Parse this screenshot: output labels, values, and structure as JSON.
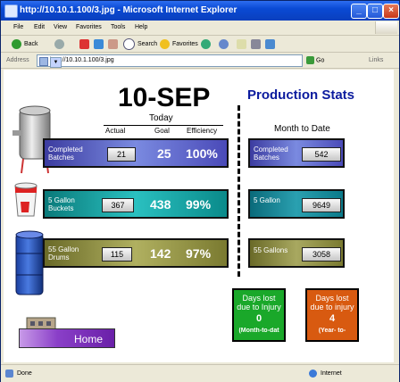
{
  "window": {
    "title": "http://10.10.1.100/3.jpg - Microsoft Internet Explorer",
    "minimize": "_",
    "maximize": "□",
    "close": "×"
  },
  "menu": [
    "File",
    "Edit",
    "View",
    "Favorites",
    "Tools",
    "Help"
  ],
  "toolbar": {
    "back": "Back",
    "search": "Search",
    "favorites": "Favorites"
  },
  "address": {
    "label": "Address",
    "url": "http://10.10.1.100/3.jpg",
    "go": "Go",
    "links": "Links"
  },
  "status": {
    "text": "Done",
    "zone": "Internet"
  },
  "page": {
    "date": "10-SEP",
    "title": "Production Stats",
    "today_label": "Today",
    "mtd_label": "Month to Date",
    "columns": {
      "actual": "Actual",
      "goal": "Goal",
      "efficiency": "Efficiency"
    },
    "rows": [
      {
        "label1": "Completed",
        "label2": "Batches",
        "actual": "21",
        "goal": "25",
        "efficiency": "100%",
        "mtd_label1": "Completed",
        "mtd_label2": "Batches",
        "mtd": "542"
      },
      {
        "label1": "5 Gallon",
        "label2": "Buckets",
        "actual": "367",
        "goal": "438",
        "efficiency": "99%",
        "mtd_label1": "5 Gallon",
        "mtd_label2": "",
        "mtd": "9649"
      },
      {
        "label1": "55 Gallon",
        "label2": "Drums",
        "actual": "115",
        "goal": "142",
        "efficiency": "97%",
        "mtd_label1": "55 Gallons",
        "mtd_label2": "",
        "mtd": "3058"
      }
    ],
    "injury_month": {
      "line1": "Days lost",
      "line2": "due to Injury",
      "value": "0",
      "period": "(Month-to-dat"
    },
    "injury_year": {
      "line1": "Days lost",
      "line2": "due to injury",
      "value": "4",
      "period": "(Year- to-"
    },
    "home": "Home"
  },
  "colors": {
    "row1": "#5a5fc8",
    "row2": "#0f9a9a",
    "row3": "#8a8a3a",
    "injury_month": "#1aa82a",
    "injury_year": "#d85a10",
    "title": "#0b1b9e"
  }
}
